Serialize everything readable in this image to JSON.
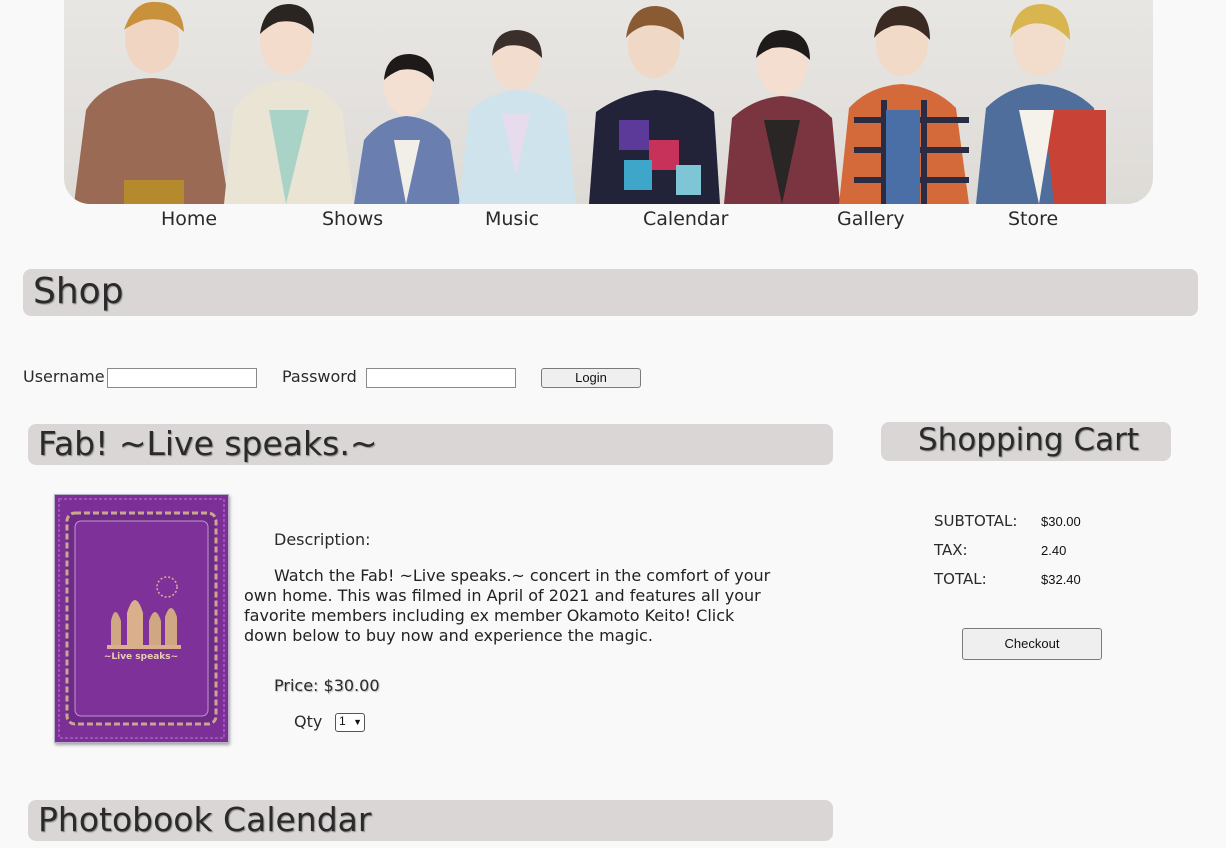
{
  "banner": {
    "alt": "group photo"
  },
  "nav": {
    "items": [
      {
        "label": "Home"
      },
      {
        "label": "Shows"
      },
      {
        "label": "Music"
      },
      {
        "label": "Calendar"
      },
      {
        "label": "Gallery"
      },
      {
        "label": "Store"
      }
    ]
  },
  "shop": {
    "title": "Shop"
  },
  "login": {
    "username_label": "Username",
    "username_value": "",
    "password_label": "Password",
    "password_value": "",
    "button_label": "Login"
  },
  "products": [
    {
      "title": "Fab! ~Live speaks.~",
      "description_label": "Description:",
      "description": "Watch the Fab! ~Live speaks.~ concert in the comfort of your own home. This was filmed in April of 2021 and features all your favorite members including ex member Okamoto Keito! Click down below to buy now and experience the magic.",
      "price_label": "Price: $30.00",
      "qty_label": "Qty",
      "qty_value": "1",
      "image_text": "~Live speaks~",
      "image_color": "#7a2f96"
    },
    {
      "title": "Photobook Calendar"
    }
  ],
  "cart": {
    "title": "Shopping Cart",
    "subtotal_label": "SUBTOTAL:",
    "subtotal_value": "$30.00",
    "tax_label": "TAX:",
    "tax_value": "2.40",
    "total_label": "TOTAL:",
    "total_value": "$32.40",
    "checkout_label": "Checkout"
  },
  "colors": {
    "header_bar": "#d9d6d5",
    "background": "#f9f9f9",
    "product_purple": "#7a2f96"
  }
}
